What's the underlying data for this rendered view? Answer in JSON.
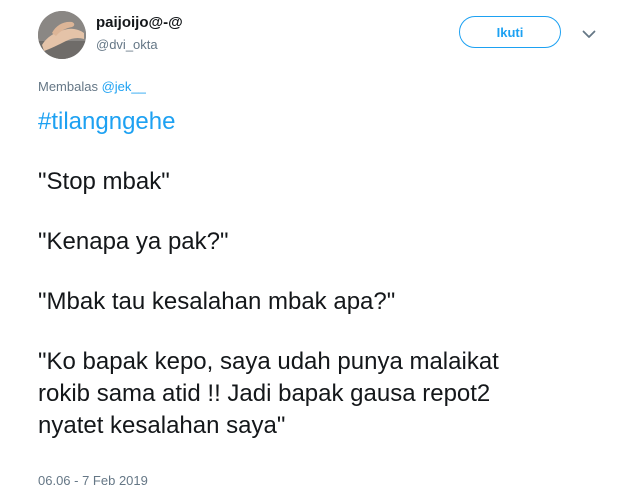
{
  "user": {
    "display_name": "paijoijo@-@",
    "handle": "@dvi_okta"
  },
  "follow_button_label": "Ikuti",
  "reply": {
    "prefix": "Membalas ",
    "mention": "@jek__"
  },
  "tweet": {
    "hashtag": "#tilangngehe",
    "line1": "\"Stop mbak\"",
    "line2": "\"Kenapa ya pak?\"",
    "line3": "\"Mbak tau kesalahan mbak apa?\"",
    "line4a": "\"Ko bapak kepo, saya udah punya malaikat",
    "line4b": "rokib sama atid !! Jadi bapak gausa repot2",
    "line4c": "nyatet kesalahan saya\""
  },
  "timestamp": "06.06 - 7 Feb 2019",
  "colors": {
    "accent": "#1da1f2",
    "muted_text": "#657786",
    "body_text": "#14171a"
  },
  "icons": {
    "more_menu": "chevron-down-icon"
  }
}
